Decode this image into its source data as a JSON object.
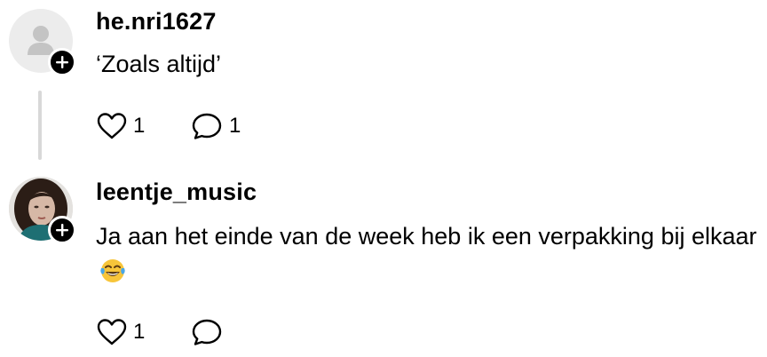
{
  "comments": [
    {
      "username": "he.nri1627",
      "text": "‘Zoals altijd’",
      "avatar": "default-user-icon",
      "likes": "1",
      "replies": "1"
    },
    {
      "username": "leentje_music",
      "text": "Ja aan het einde van de week heb ik een verpakking bij elkaar",
      "emoji": "tears-of-joy-emoji",
      "avatar": "profile-photo",
      "likes": "1",
      "replies": ""
    }
  ],
  "colors": {
    "text": "#000000",
    "badge": "#000000",
    "thread_line": "#d8d8d8",
    "avatar_default_bg": "#ececec"
  }
}
